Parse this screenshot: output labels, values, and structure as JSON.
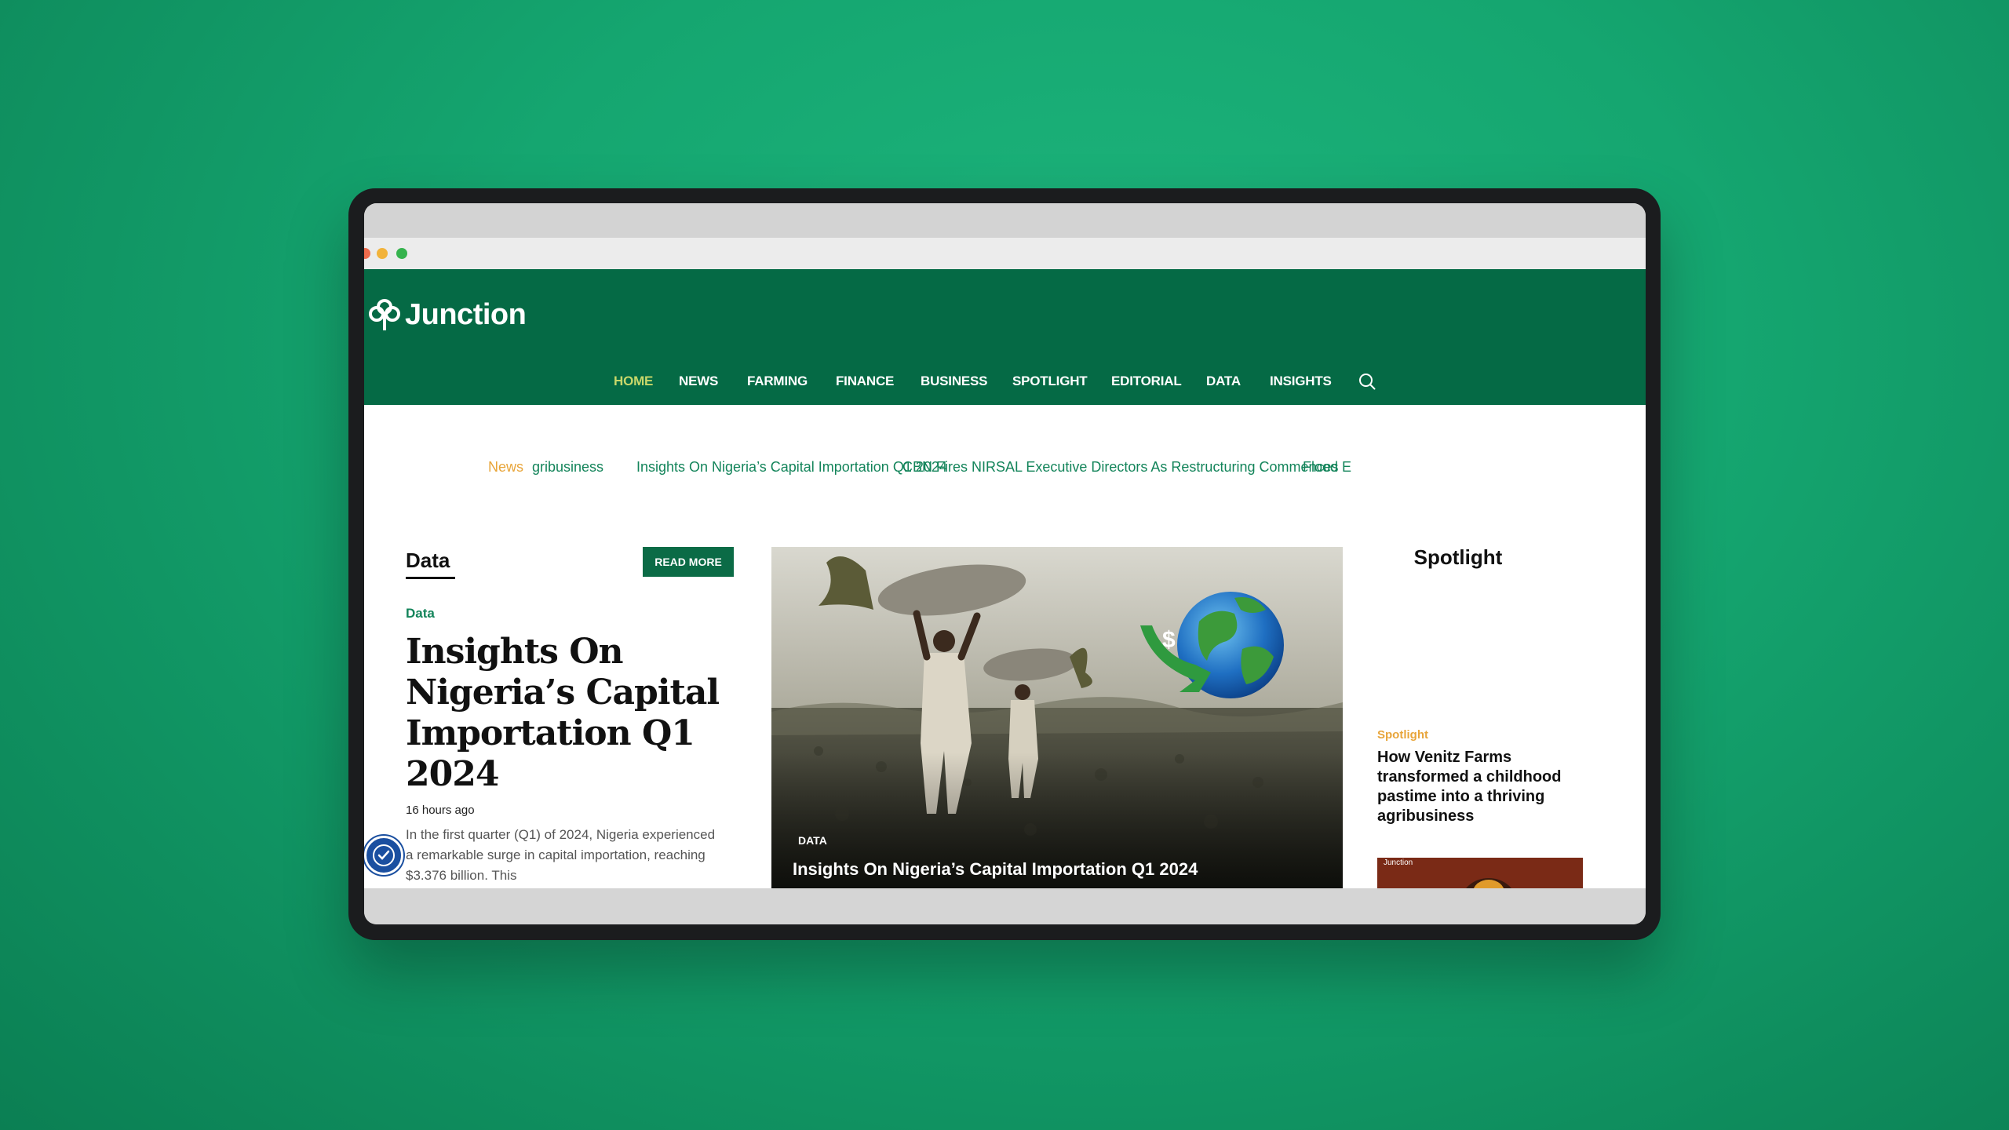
{
  "site": {
    "name": "Junction"
  },
  "nav": {
    "items": [
      {
        "label": "HOME",
        "active": true
      },
      {
        "label": "NEWS"
      },
      {
        "label": "FARMING"
      },
      {
        "label": "FINANCE"
      },
      {
        "label": "BUSINESS"
      },
      {
        "label": "SPOTLIGHT"
      },
      {
        "label": "EDITORIAL"
      },
      {
        "label": "DATA"
      },
      {
        "label": "INSIGHTS"
      }
    ],
    "search_icon": "search-icon"
  },
  "ticker": {
    "label": "News",
    "items": [
      "gribusiness",
      "Insights On Nigeria’s Capital Importation Q1 2024",
      "CBN Fires NIRSAL Executive Directors As Restructuring Commences",
      "Flood E"
    ]
  },
  "data_section": {
    "title": "Data",
    "read_more": "READ MORE",
    "category": "Data",
    "headline": "Insights On Nigeria’s Capital Importation Q1 2024",
    "time": "16 hours ago",
    "excerpt": "In the first quarter (Q1) of 2024, Nigeria experienced a remarkable surge in capital importation, reaching $3.376 billion. This"
  },
  "hero": {
    "badge": "DATA",
    "title": "Insights On Nigeria’s Capital Importation Q1 2024"
  },
  "spotlight": {
    "title": "Spotlight",
    "category": "Spotlight",
    "headline": "How Venitz Farms transformed a childhood pastime into a thriving agribusiness",
    "thumb_logo": "Junction"
  },
  "colors": {
    "brand_green": "#056a45",
    "accent_yellow": "#e8a53a",
    "link_green": "#13845a",
    "nav_active": "#c8d76a"
  }
}
